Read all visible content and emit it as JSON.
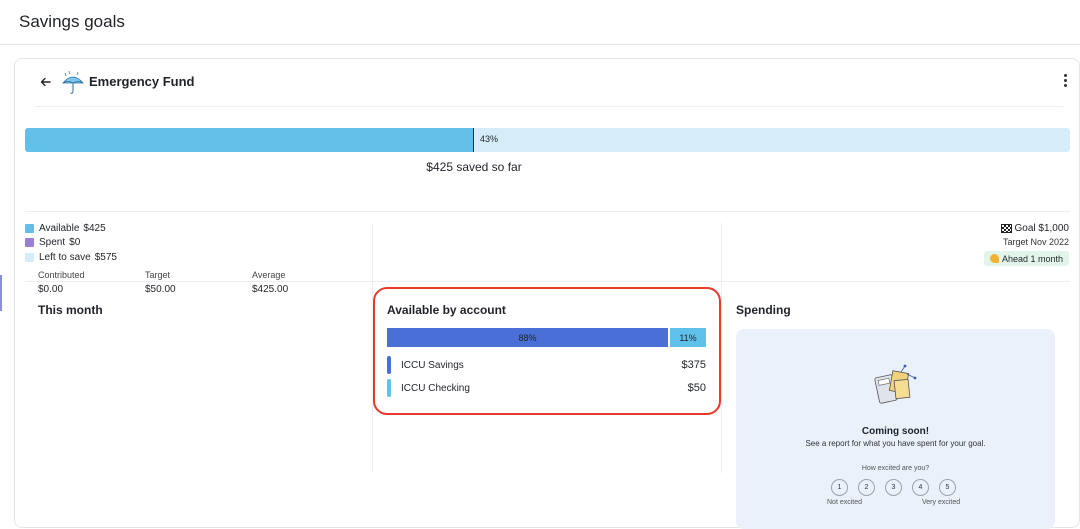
{
  "page": {
    "title": "Savings goals"
  },
  "goal": {
    "name": "Emergency Fund",
    "progress_fraction": 0.43,
    "progress_pct_label": "43%",
    "saved_label": "$425 saved so far"
  },
  "legend": [
    {
      "label": "Available",
      "value": "$425",
      "color": "#62bfe8"
    },
    {
      "label": "Spent",
      "value": "$0",
      "color": "#9b7fd1"
    },
    {
      "label": "Left to save",
      "value": "$575",
      "color": "#d5ecf9"
    }
  ],
  "goal_info": {
    "goal_label": "Goal $1,000",
    "target_label": "Target Nov 2022",
    "ahead_label": "Ahead 1 month"
  },
  "this_month": {
    "title": "This month",
    "stats": [
      {
        "label": "Contributed",
        "value": "$0.00"
      },
      {
        "label": "Target",
        "value": "$50.00"
      },
      {
        "label": "Average",
        "value": "$425.00"
      }
    ]
  },
  "available_by_account": {
    "title": "Available by account",
    "segments": [
      {
        "label": "88%",
        "fraction": 0.88,
        "color": "#4a6fd6"
      },
      {
        "label": "11%",
        "fraction": 0.11,
        "color": "#5fc1ea"
      }
    ],
    "accounts": [
      {
        "name": "ICCU Savings",
        "amount": "$375",
        "color": "#4a6fd6"
      },
      {
        "name": "ICCU Checking",
        "amount": "$50",
        "color": "#5fc1ea"
      }
    ]
  },
  "spending": {
    "title": "Spending",
    "coming_soon_title": "Coming soon!",
    "coming_soon_desc": "See a report for what you have spent for your goal.",
    "excited_question": "How excited are you?",
    "ratings": [
      "1",
      "2",
      "3",
      "4",
      "5"
    ],
    "scale_low": "Not excited",
    "scale_high": "Very excited"
  }
}
